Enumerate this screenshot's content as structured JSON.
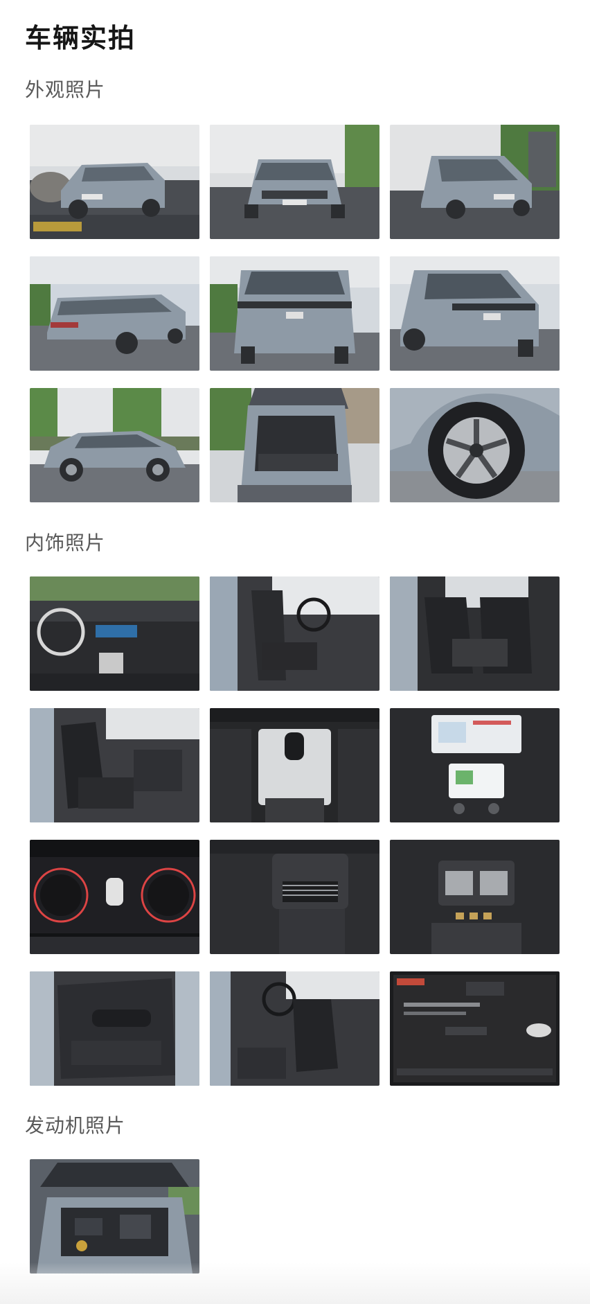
{
  "page": {
    "title": "车辆实拍"
  },
  "sections": {
    "exterior": {
      "title": "外观照片",
      "photos": [
        {
          "subject": "front-left-three-quarter-view"
        },
        {
          "subject": "front-view"
        },
        {
          "subject": "front-right-three-quarter-view"
        },
        {
          "subject": "rear-left-three-quarter-view"
        },
        {
          "subject": "rear-view"
        },
        {
          "subject": "rear-right-three-quarter-view"
        },
        {
          "subject": "side-profile-view"
        },
        {
          "subject": "open-trunk-view"
        },
        {
          "subject": "wheel-close-up"
        }
      ]
    },
    "interior": {
      "title": "内饰照片",
      "photos": [
        {
          "subject": "dashboard-and-steering-wheel"
        },
        {
          "subject": "driver-seat-from-door"
        },
        {
          "subject": "rear-seats"
        },
        {
          "subject": "front-seats-side-view"
        },
        {
          "subject": "gear-shifter-console"
        },
        {
          "subject": "infotainment-screens"
        },
        {
          "subject": "instrument-cluster"
        },
        {
          "subject": "rear-air-vents"
        },
        {
          "subject": "rear-vents-and-usb-ports"
        },
        {
          "subject": "door-panel"
        },
        {
          "subject": "driver-seat-angle"
        },
        {
          "subject": "infotainment-menu-screen"
        }
      ]
    },
    "engine": {
      "title": "发动机照片",
      "photos": [
        {
          "subject": "engine-bay"
        }
      ]
    }
  },
  "colors": {
    "car_body": "#8e9aa6",
    "page_background": "#ffffff",
    "section_title": "#595959"
  }
}
